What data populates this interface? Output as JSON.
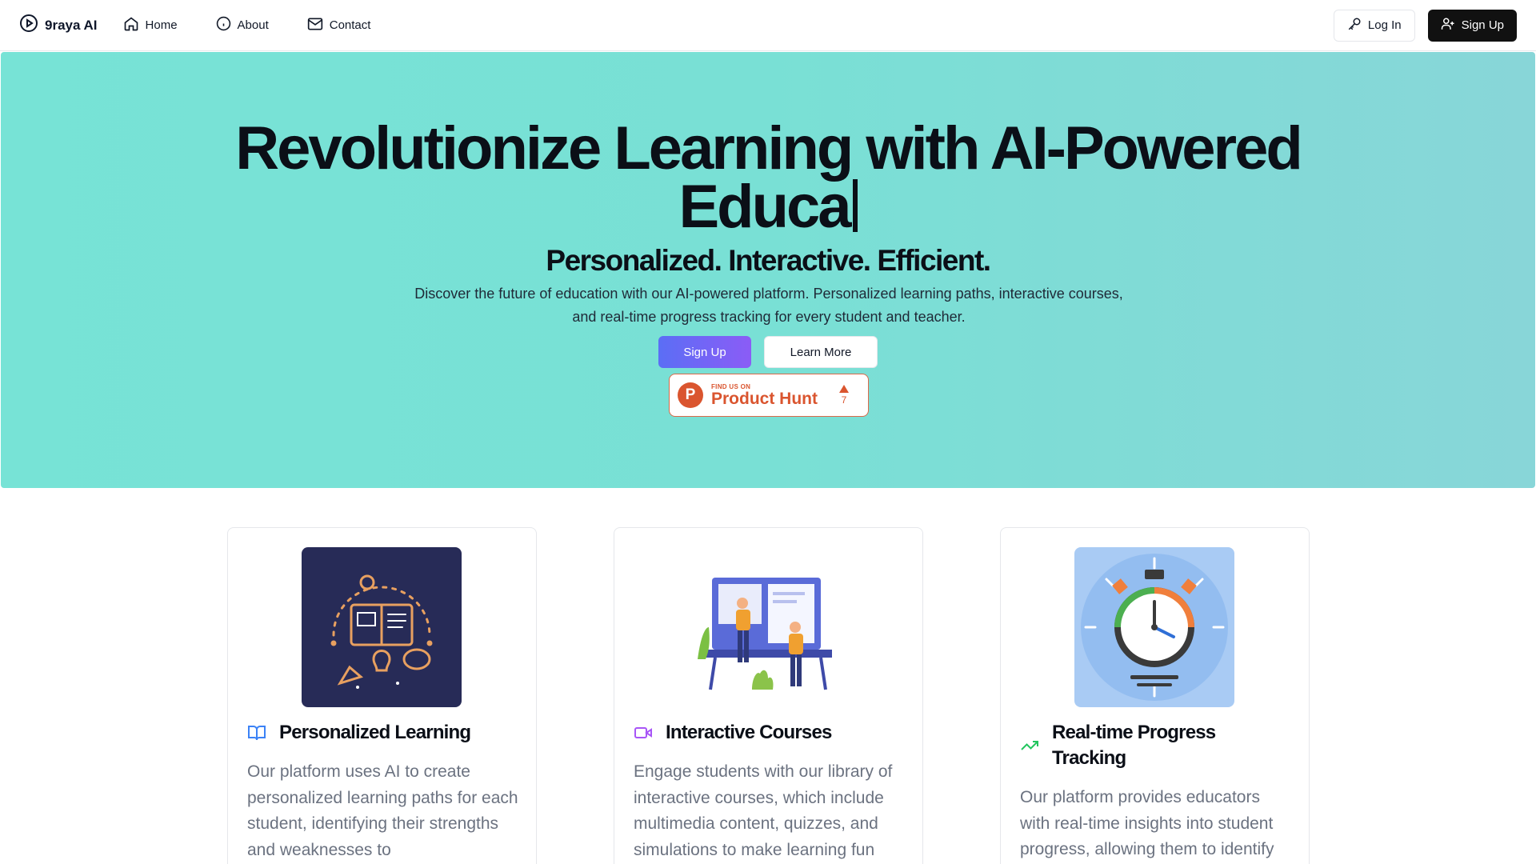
{
  "nav": {
    "brand": "9raya AI",
    "links": [
      {
        "label": "Home",
        "icon": "home-icon"
      },
      {
        "label": "About",
        "icon": "info-icon"
      },
      {
        "label": "Contact",
        "icon": "mail-icon"
      }
    ],
    "login_label": "Log In",
    "signup_label": "Sign Up"
  },
  "hero": {
    "title_line1": "Revolutionize Learning with AI-Powered",
    "title_line2": "Educa",
    "subtitle": "Personalized. Interactive. Efficient.",
    "description": "Discover the future of education with our AI-powered platform. Personalized learning paths, interactive courses, and real-time progress tracking for every student and teacher.",
    "signup_label": "Sign Up",
    "learn_more_label": "Learn More",
    "gradient": [
      "#77e3d6",
      "#88d6d8"
    ],
    "product_hunt": {
      "small": "FIND US ON",
      "big": "Product Hunt",
      "votes": "7",
      "logo_letter": "P",
      "color": "#da552f"
    }
  },
  "features": [
    {
      "title": "Personalized Learning",
      "icon": "book-open-icon",
      "icon_color": "#3b82f6",
      "text": "Our platform uses AI to create personalized learning paths for each student, identifying their strengths and weaknesses to"
    },
    {
      "title": "Interactive Courses",
      "icon": "video-icon",
      "icon_color": "#a855f7",
      "text": "Engage students with our library of interactive courses, which include multimedia content, quizzes, and simulations to make learning fun"
    },
    {
      "title": "Real-time Progress Tracking",
      "icon": "trending-up-icon",
      "icon_color": "#22c55e",
      "text": "Our platform provides educators with real-time insights into student progress, allowing them to identify"
    }
  ]
}
